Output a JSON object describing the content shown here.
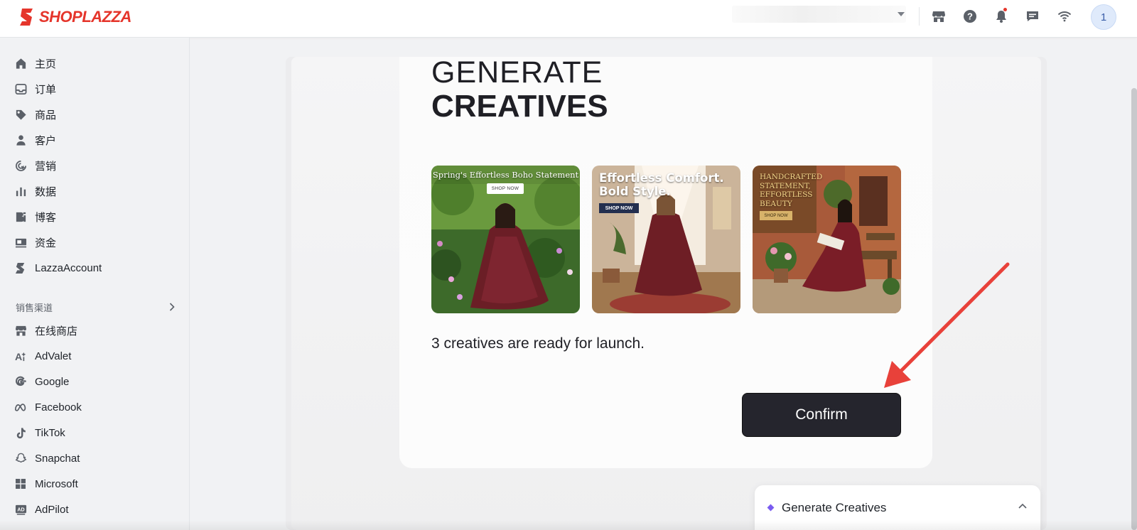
{
  "brand": {
    "name": "SHOPLAZZA",
    "color": "#e5352b"
  },
  "header": {
    "store_selector": "",
    "icons": [
      "store-icon",
      "help-icon",
      "bell-icon",
      "chat-icon",
      "wifi-icon"
    ],
    "avatar_text": "1"
  },
  "sidebar": {
    "items": [
      {
        "label": "主页",
        "icon": "home-icon"
      },
      {
        "label": "订单",
        "icon": "inbox-icon"
      },
      {
        "label": "商品",
        "icon": "tag-icon"
      },
      {
        "label": "客户",
        "icon": "user-icon"
      },
      {
        "label": "营销",
        "icon": "marketing-icon"
      },
      {
        "label": "数据",
        "icon": "bar-chart-icon"
      },
      {
        "label": "博客",
        "icon": "blog-icon"
      },
      {
        "label": "资金",
        "icon": "wallet-icon"
      },
      {
        "label": "LazzaAccount",
        "icon": "lazza-icon"
      }
    ],
    "section_label": "销售渠道",
    "channels": [
      {
        "label": "在线商店",
        "icon": "store-icon"
      },
      {
        "label": "AdValet",
        "icon": "advalet-icon"
      },
      {
        "label": "Google",
        "icon": "google-icon"
      },
      {
        "label": "Facebook",
        "icon": "meta-icon"
      },
      {
        "label": "TikTok",
        "icon": "tiktok-icon"
      },
      {
        "label": "Snapchat",
        "icon": "snapchat-icon"
      },
      {
        "label": "Microsoft",
        "icon": "microsoft-icon"
      },
      {
        "label": "AdPilot",
        "icon": "adpilot-icon"
      }
    ]
  },
  "main": {
    "title_line1": "GENERATE",
    "title_line2": "CREATIVES",
    "creatives": [
      {
        "headline": "Spring's Effortless Boho Statement",
        "cta": "SHOP NOW"
      },
      {
        "headline": "Effortless Comfort. Bold Style.",
        "cta": "SHOP NOW"
      },
      {
        "headline": "HANDCRAFTED STATEMENT, EFFORTLESS BEAUTY",
        "cta": "SHOP NOW"
      }
    ],
    "ready_text": "3 creatives are ready for launch.",
    "confirm_label": "Confirm"
  },
  "float_panel": {
    "label": "Generate Creatives"
  },
  "colors": {
    "accent_dark": "#25252d",
    "arrow_red": "#e8413a",
    "diamond": "#7a5cf0"
  }
}
